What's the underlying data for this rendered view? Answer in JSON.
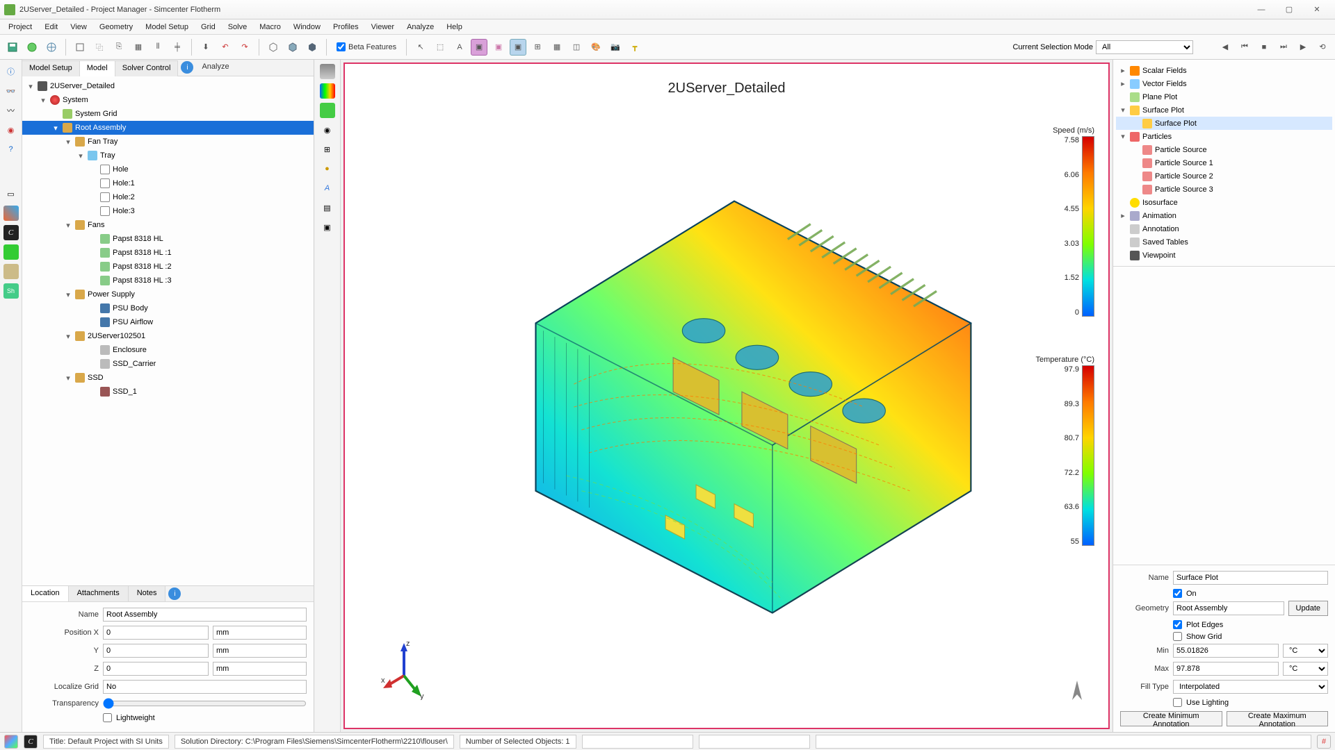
{
  "window": {
    "title": "2UServer_Detailed - Project Manager - Simcenter Flotherm"
  },
  "menus": [
    "Project",
    "Edit",
    "View",
    "Geometry",
    "Model Setup",
    "Grid",
    "Solve",
    "Macro",
    "Window",
    "Profiles",
    "Viewer",
    "Analyze",
    "Help"
  ],
  "toolbar": {
    "beta_label": "Beta Features",
    "selection_mode_label": "Current Selection Mode",
    "selection_mode_value": "All"
  },
  "left_tabs": {
    "t1": "Model Setup",
    "t2": "Model",
    "t3": "Solver Control",
    "analyze": "Analyze"
  },
  "tree": {
    "root": "2UServer_Detailed",
    "system": "System",
    "system_grid": "System Grid",
    "root_asm": "Root Assembly",
    "fan_tray": "Fan Tray",
    "tray": "Tray",
    "hole": "Hole",
    "hole1": "Hole:1",
    "hole2": "Hole:2",
    "hole3": "Hole:3",
    "fans": "Fans",
    "fan0": "Papst 8318 HL",
    "fan1": "Papst 8318 HL  :1",
    "fan2": "Papst 8318 HL  :2",
    "fan3": "Papst 8318 HL  :3",
    "psu": "Power Supply",
    "psu_body": "PSU Body",
    "psu_air": "PSU Airflow",
    "server": "2UServer102501",
    "enclosure": "Enclosure",
    "ssd_carrier": "SSD_Carrier",
    "ssd": "SSD",
    "ssd1": "SSD_1"
  },
  "prop_tabs": {
    "t1": "Location",
    "t2": "Attachments",
    "t3": "Notes"
  },
  "props": {
    "name_label": "Name",
    "name_value": "Root Assembly",
    "px_label": "Position X",
    "px_value": "0",
    "px_unit": "mm",
    "py_label": "Y",
    "py_value": "0",
    "py_unit": "mm",
    "pz_label": "Z",
    "pz_value": "0",
    "pz_unit": "mm",
    "loc_label": "Localize Grid",
    "loc_value": "No",
    "trans_label": "Transparency",
    "light_label": "Lightweight"
  },
  "viewport": {
    "title": "2UServer_Detailed",
    "speed_title": "Speed (m/s)",
    "speed_ticks": [
      "7.58",
      "6.06",
      "4.55",
      "3.03",
      "1.52",
      "0"
    ],
    "temp_title": "Temperature (°C)",
    "temp_ticks": [
      "97.9",
      "89.3",
      "80.7",
      "72.2",
      "63.6",
      "55"
    ]
  },
  "rtree": {
    "scalar": "Scalar Fields",
    "vector": "Vector Fields",
    "plane": "Plane Plot",
    "surface": "Surface Plot",
    "surface_child": "Surface Plot",
    "particles": "Particles",
    "ps": "Particle Source",
    "ps1": "Particle Source 1",
    "ps2": "Particle Source 2",
    "ps3": "Particle Source 3",
    "iso": "Isosurface",
    "anim": "Animation",
    "annot": "Annotation",
    "saved": "Saved Tables",
    "view": "Viewpoint"
  },
  "rprops": {
    "name_label": "Name",
    "name_value": "Surface Plot",
    "on_label": "On",
    "geom_label": "Geometry",
    "geom_value": "Root Assembly",
    "update": "Update",
    "plot_edges": "Plot Edges",
    "show_grid": "Show Grid",
    "min_label": "Min",
    "min_value": "55.01826",
    "min_unit": "°C",
    "max_label": "Max",
    "max_value": "97.878",
    "max_unit": "°C",
    "fill_label": "Fill Type",
    "fill_value": "Interpolated",
    "lighting": "Use Lighting",
    "create_min": "Create Minimum Annotation",
    "create_max": "Create Maximum Annotation"
  },
  "status": {
    "title": "Title: Default Project with SI Units",
    "soldir": "Solution Directory:  C:\\Program Files\\Siemens\\SimcenterFlotherm\\2210\\flouser\\",
    "sel": "Number of Selected Objects: 1"
  }
}
